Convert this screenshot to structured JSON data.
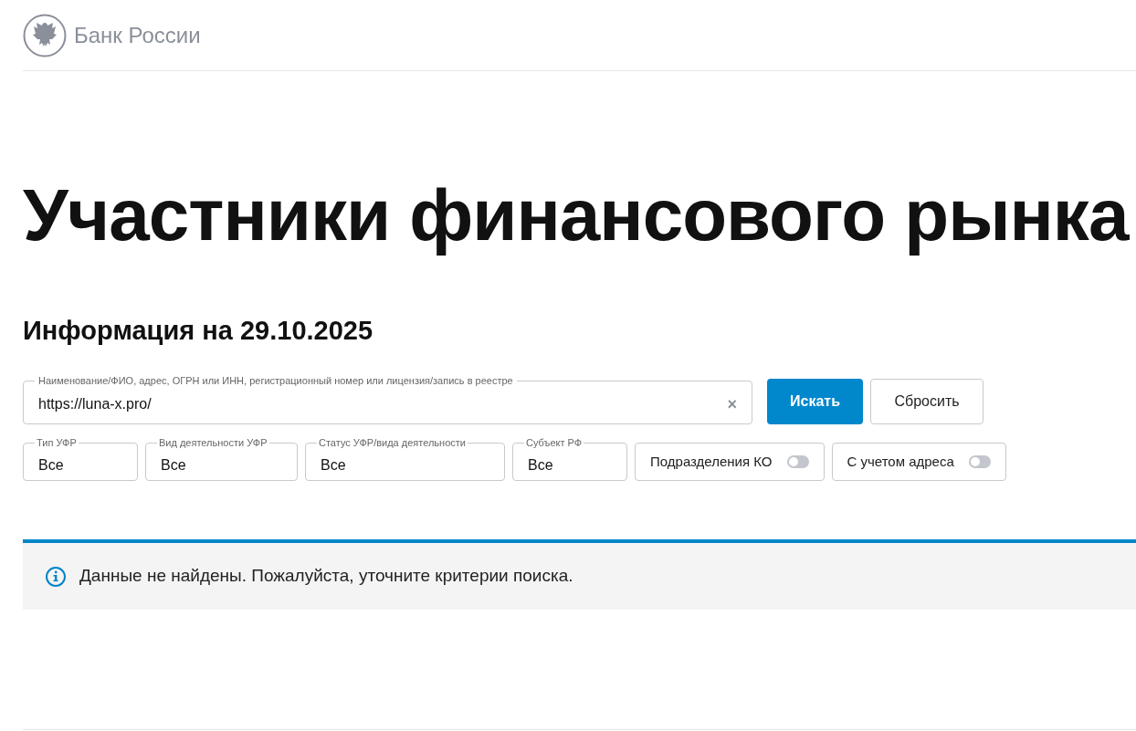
{
  "header": {
    "logo_text": "Банк России"
  },
  "title": "Участники финансового рынка",
  "subtitle": "Информация на 29.10.2025",
  "search": {
    "label": "Наименование/ФИО, адрес, ОГРН или ИНН, регистрационный номер или лицензия/запись в реестре",
    "value": "https://luna-x.pro/",
    "clear": "×"
  },
  "buttons": [
    {
      "label": "Искать",
      "kind": "primary"
    },
    {
      "label": "Сбросить",
      "kind": "secondary"
    }
  ],
  "filters": [
    {
      "kind": "select",
      "label": "Тип УФР",
      "value": "Все"
    },
    {
      "kind": "select",
      "label": "Вид деятельности УФР",
      "value": "Все"
    },
    {
      "kind": "select",
      "label": "Статус УФР/вида деятельности",
      "value": "Все"
    },
    {
      "kind": "select",
      "label": "Субъект РФ",
      "value": "Все"
    },
    {
      "kind": "toggle",
      "label": "Подразделения КО",
      "on": false
    },
    {
      "kind": "toggle",
      "label": "С учетом адреса",
      "on": false
    }
  ],
  "notice": {
    "text": "Данные не найдены. Пожалуйста, уточните критерии поиска."
  }
}
